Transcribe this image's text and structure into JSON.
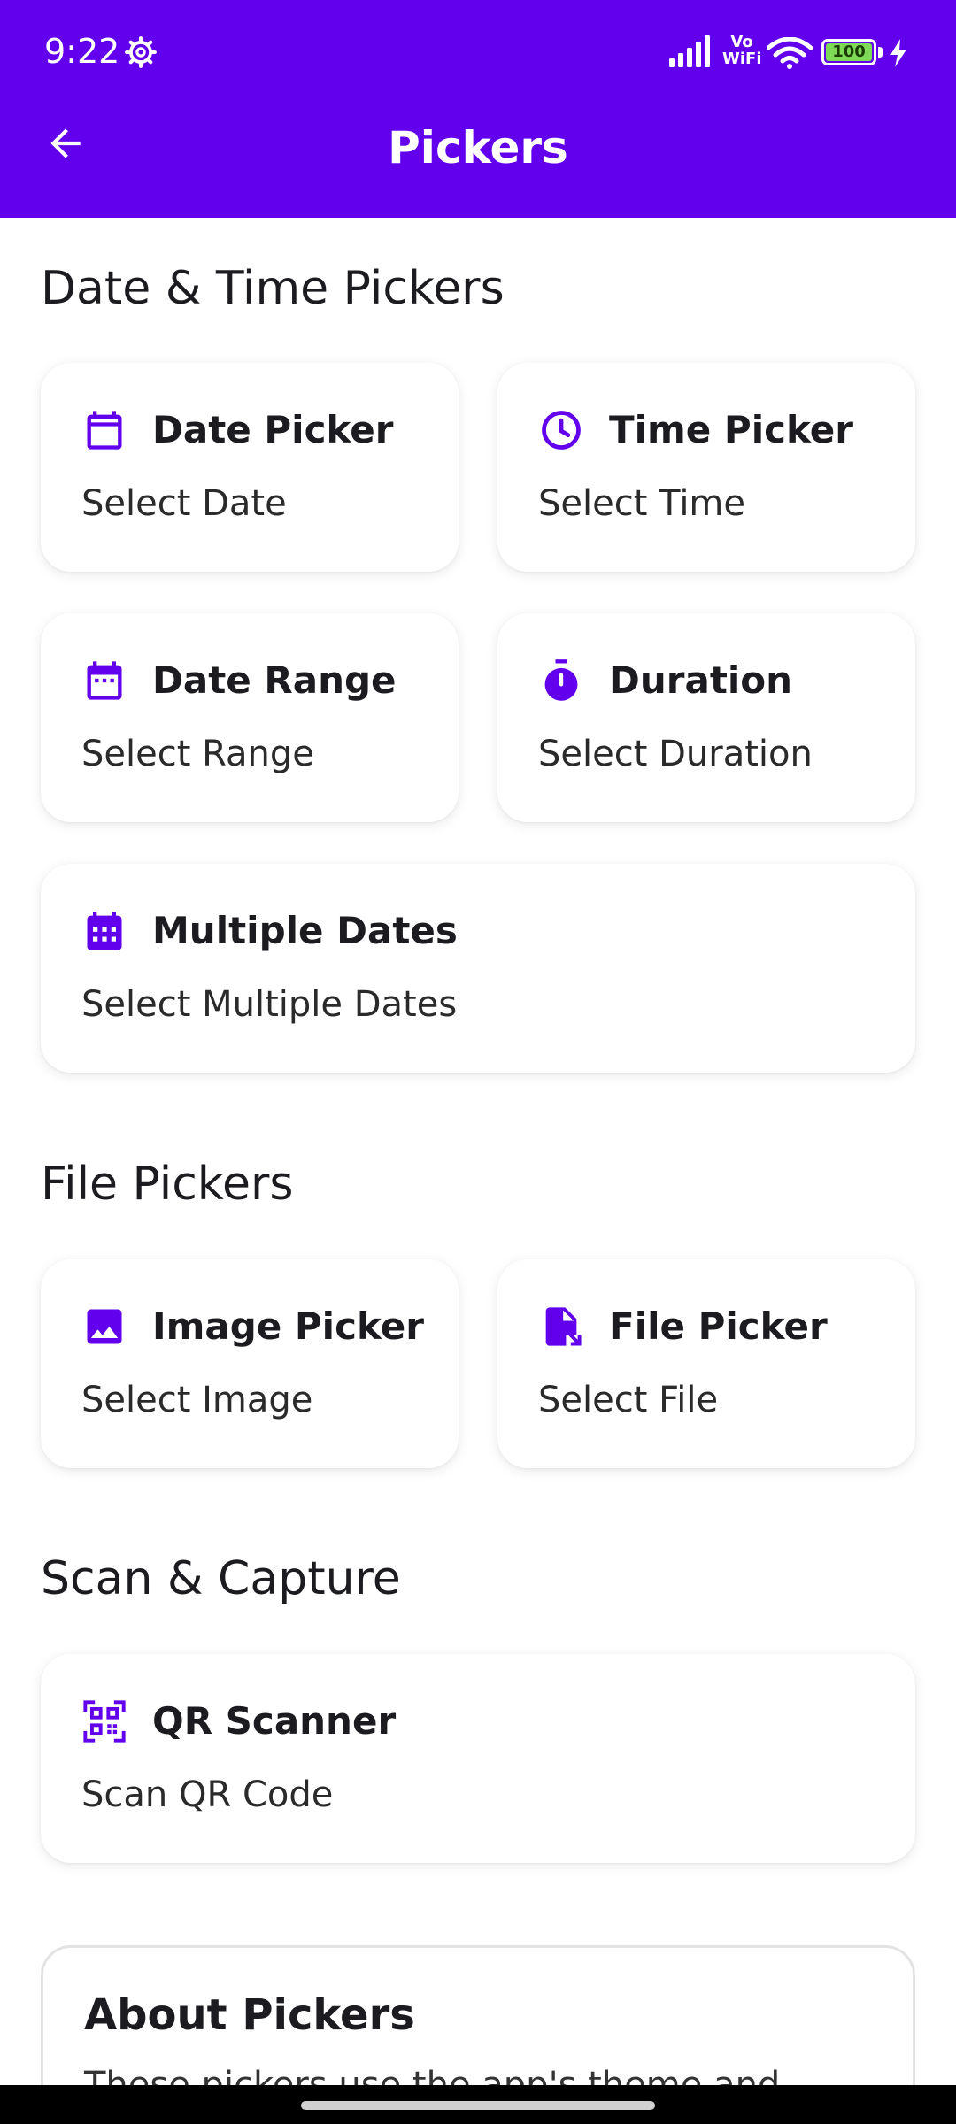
{
  "status_bar": {
    "time": "9:22",
    "network_label": "Vo WiFi",
    "battery_level": "100"
  },
  "app_bar": {
    "title": "Pickers"
  },
  "colors": {
    "primary": "#6200ee",
    "background": "#ffffff",
    "battery": "#7ed957"
  },
  "sections": {
    "date_time": {
      "title": "Date & Time Pickers",
      "date_picker": {
        "title": "Date Picker",
        "subtitle": "Select Date",
        "icon": "calendar-icon"
      },
      "time_picker": {
        "title": "Time Picker",
        "subtitle": "Select Time",
        "icon": "clock-icon"
      },
      "date_range": {
        "title": "Date Range",
        "subtitle": "Select Range",
        "icon": "calendar-range-icon"
      },
      "duration": {
        "title": "Duration",
        "subtitle": "Select Duration",
        "icon": "timer-icon"
      },
      "multiple_dates": {
        "title": "Multiple Dates",
        "subtitle": "Select Multiple Dates",
        "icon": "calendar-grid-icon"
      }
    },
    "file": {
      "title": "File Pickers",
      "image_picker": {
        "title": "Image Picker",
        "subtitle": "Select Image",
        "icon": "image-icon"
      },
      "file_picker": {
        "title": "File Picker",
        "subtitle": "Select File",
        "icon": "file-icon"
      }
    },
    "scan": {
      "title": "Scan & Capture",
      "qr_scanner": {
        "title": "QR Scanner",
        "subtitle": "Scan QR Code",
        "icon": "qr-code-icon"
      }
    },
    "about": {
      "title": "About Pickers",
      "body": "These pickers use the app's theme and"
    }
  }
}
